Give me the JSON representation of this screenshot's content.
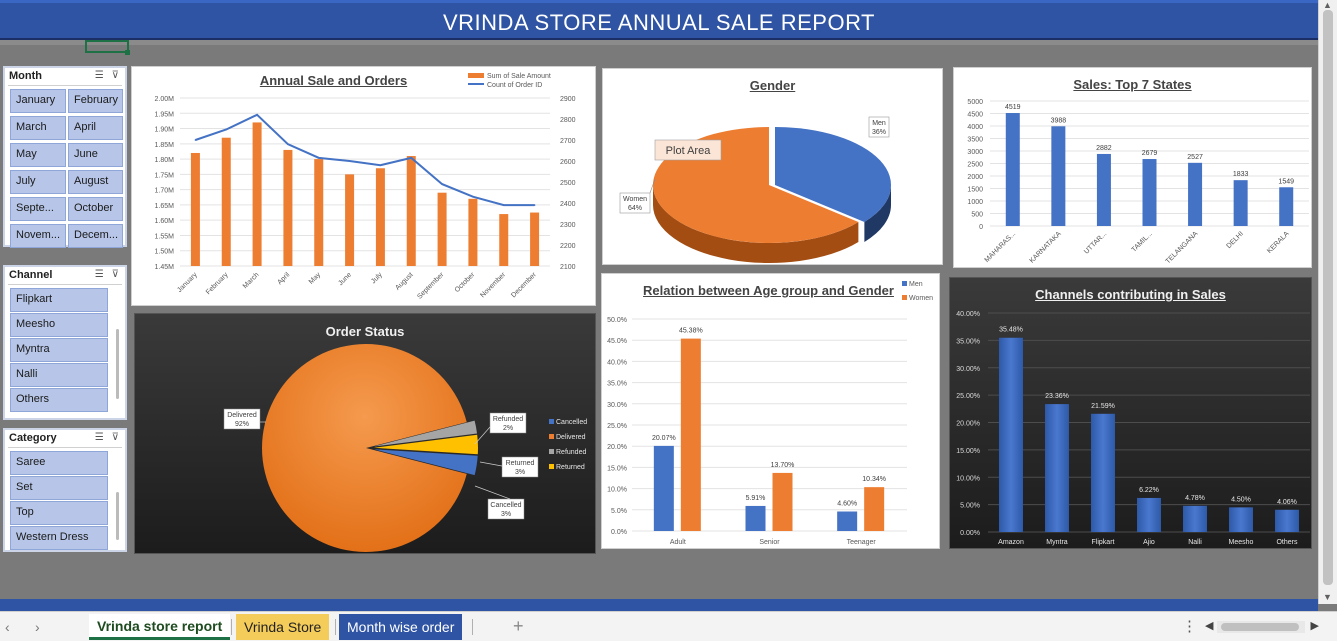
{
  "report": {
    "title": "VRINDA STORE ANNUAL SALE REPORT"
  },
  "slicers": {
    "month": {
      "label": "Month",
      "items": [
        "January",
        "February",
        "March",
        "April",
        "May",
        "June",
        "July",
        "August",
        "Septe...",
        "October",
        "Novem...",
        "Decem..."
      ]
    },
    "channel": {
      "label": "Channel",
      "items": [
        "Flipkart",
        "Meesho",
        "Myntra",
        "Nalli",
        "Others"
      ]
    },
    "category": {
      "label": "Category",
      "items": [
        "Saree",
        "Set",
        "Top",
        "Western Dress"
      ]
    },
    "icons": {
      "multi_select": "multi-select-icon",
      "clear_filter": "clear-filter-icon"
    }
  },
  "colors": {
    "accent_blue": "#4472c4",
    "accent_orange": "#ed7d31",
    "grey": "#a5a5a5",
    "gold": "#ffc000",
    "title_bar": "#2f54a3"
  },
  "chart_data": [
    {
      "id": "annual",
      "type": "bar",
      "title": "Annual Sale and Orders",
      "categories": [
        "January",
        "February",
        "March",
        "April",
        "May",
        "June",
        "July",
        "August",
        "September",
        "October",
        "November",
        "December"
      ],
      "series": [
        {
          "name": "Sum of Sale Amount",
          "type": "bar",
          "axis": "left",
          "values": [
            1.82,
            1.87,
            1.92,
            1.83,
            1.8,
            1.75,
            1.77,
            1.81,
            1.69,
            1.67,
            1.62,
            1.625
          ]
        },
        {
          "name": "Count of Order ID",
          "type": "line",
          "axis": "right",
          "values": [
            2700,
            2750,
            2820,
            2680,
            2615,
            2600,
            2580,
            2615,
            2490,
            2430,
            2390,
            2390
          ]
        }
      ],
      "y_left": {
        "min": 1.45,
        "max": 2.0,
        "ticks": [
          "2.00M",
          "1.95M",
          "1.90M",
          "1.85M",
          "1.80M",
          "1.75M",
          "1.70M",
          "1.65M",
          "1.60M",
          "1.55M",
          "1.50M",
          "1.45M"
        ]
      },
      "y_right": {
        "min": 2100,
        "max": 2900,
        "ticks": [
          "2900",
          "2800",
          "2700",
          "2600",
          "2500",
          "2400",
          "2300",
          "2200",
          "2100"
        ]
      },
      "legend": "top-right"
    },
    {
      "id": "gender",
      "type": "pie",
      "title": "Gender",
      "slices": [
        {
          "label": "Men",
          "pct": "36%",
          "value": 36
        },
        {
          "label": "Women",
          "pct": "64%",
          "value": 64
        }
      ],
      "annotation": "Plot Area"
    },
    {
      "id": "states",
      "type": "bar",
      "title": "Sales: Top 7  States",
      "categories": [
        "MAHARAS...",
        "KARNATAKA",
        "UTTAR...",
        "TAMIL...",
        "TELANGANA",
        "DELHI",
        "KERALA"
      ],
      "values": [
        4519,
        3988,
        2882,
        2679,
        2527,
        1833,
        1549
      ],
      "ylim": [
        0,
        5000
      ],
      "yticks": [
        "5000",
        "4500",
        "4000",
        "3500",
        "3000",
        "2500",
        "2000",
        "1500",
        "1000",
        "500",
        "0"
      ]
    },
    {
      "id": "order_status",
      "type": "pie",
      "title": "Order Status",
      "slices": [
        {
          "label": "Delivered",
          "pct": "92%",
          "value": 92
        },
        {
          "label": "Refunded",
          "pct": "2%",
          "value": 2
        },
        {
          "label": "Returned",
          "pct": "3%",
          "value": 3
        },
        {
          "label": "Cancelled",
          "pct": "3%",
          "value": 3
        }
      ],
      "legend": [
        "Cancelled",
        "Delivered",
        "Refunded",
        "Returned"
      ]
    },
    {
      "id": "age_gender",
      "type": "bar",
      "title": "Relation between Age group and Gender",
      "categories": [
        "Adult",
        "Senior",
        "Teenager"
      ],
      "series": [
        {
          "name": "Men",
          "values": [
            20.07,
            5.91,
            4.6
          ],
          "labels": [
            "20.07%",
            "5.91%",
            "4.60%"
          ]
        },
        {
          "name": "Women",
          "values": [
            45.38,
            13.7,
            10.34
          ],
          "labels": [
            "45.38%",
            "13.70%",
            "10.34%"
          ]
        }
      ],
      "ylim": [
        0,
        50
      ],
      "yticks": [
        "50.0%",
        "45.0%",
        "40.0%",
        "35.0%",
        "30.0%",
        "25.0%",
        "20.0%",
        "15.0%",
        "10.0%",
        "5.0%",
        "0.0%"
      ],
      "legend": "top-right"
    },
    {
      "id": "channels",
      "type": "bar",
      "title": "Channels contributing in Sales",
      "categories": [
        "Amazon",
        "Myntra",
        "Flipkart",
        "Ajio",
        "Nalli",
        "Meesho",
        "Others"
      ],
      "values": [
        35.48,
        23.36,
        21.59,
        6.22,
        4.78,
        4.5,
        4.06
      ],
      "labels": [
        "35.48%",
        "23.36%",
        "21.59%",
        "6.22%",
        "4.78%",
        "4.50%",
        "4.06%"
      ],
      "ylim": [
        0,
        40
      ],
      "yticks": [
        "40.00%",
        "35.00%",
        "30.00%",
        "25.00%",
        "20.00%",
        "15.00%",
        "10.00%",
        "5.00%",
        "0.00%"
      ]
    }
  ],
  "tabs": {
    "items": [
      {
        "label": "Vrinda store report",
        "state": "active"
      },
      {
        "label": "Vrinda Store",
        "state": "yellow"
      },
      {
        "label": "Month wise order",
        "state": "blue"
      }
    ],
    "add_label": "+",
    "more_label": "⋮",
    "prev_label": "‹",
    "next_label": "›"
  }
}
